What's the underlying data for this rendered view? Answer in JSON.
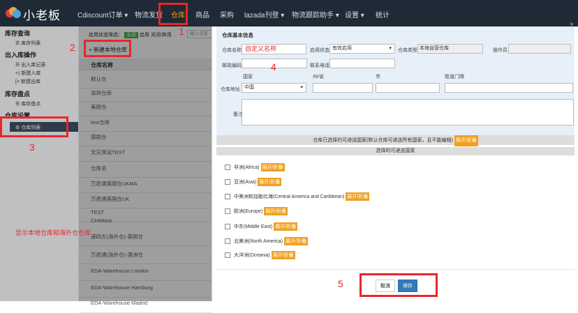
{
  "app": {
    "logo_text": "小老板"
  },
  "nav": [
    "Cdiscount订单 ▾",
    "物流发货",
    "仓库",
    "商品",
    "采购",
    "lazada刊登 ▾",
    "物流跟踪助手 ▾",
    "设置 ▾",
    "统计"
  ],
  "sidebar": {
    "sections": [
      {
        "title": "库存查询",
        "items": [
          "☰ 库存列表"
        ]
      },
      {
        "title": "出入库操作",
        "items": [
          "☰ 出入库记录",
          "+) 新建入库",
          "[> 新建出库"
        ]
      },
      {
        "title": "库存盘点",
        "items": [
          "☰ 库存盘点"
        ]
      },
      {
        "title": "仓库设置",
        "items": [
          "⚙ 仓库列表"
        ]
      }
    ]
  },
  "filter": {
    "label": "启用状态筛选：",
    "all": "全部",
    "enabled": "启用",
    "closed": "关闭/弃用",
    "search_placeholder": "输入仓库"
  },
  "new_button": "+ 新建本地仓库",
  "table": {
    "header": "仓库名称",
    "rows": [
      "默认仓",
      "深圳仓库",
      "美国仓",
      "test仓库",
      "德国仓",
      "文兄测试TEST",
      "仓库名",
      "万邑通英国仓UKMA",
      "万邑通英国仓UK",
      "TEST",
      "CHWtest",
      "递四方(海外仓)-英国仓",
      "万邑通(海外仓)-澳洲仓",
      "EDA-Warehouse London",
      "EDA-Warehouse Hamburg",
      "EDA-Warehouse Madrid"
    ]
  },
  "modal": {
    "title": "仓库基本信息",
    "name_label": "仓库名称",
    "name_value": "自定义名称",
    "status_label": "启用状态",
    "status_value": "有效启用",
    "type_label": "仓库类型",
    "type_value": "本地自营仓库",
    "operator_label": "操作员",
    "zip_label": "邮政编码",
    "phone_label": "联系电话",
    "addr_cols": [
      "国家",
      "州/省",
      "市",
      "街道门牌"
    ],
    "addr_label": "仓库地址",
    "country_value": "中国",
    "remark_label": "备注",
    "ship_note": "仓库已选择的可递送国家(默认仓库可递送所有国家，且不能编辑)",
    "expand": "展开/折叠",
    "select_title": "选择的可递送国家",
    "continents": [
      "非洲(Africa)",
      "亚洲(Asia)",
      "中美洲和加勒比海(Central America and Caribbean)",
      "欧洲(Europe)",
      "中东(Middle East)",
      "北美洲(North America)",
      "大洋洲(Oceania)"
    ],
    "cancel": "取消",
    "save": "保存",
    "close": "×"
  },
  "annotations": {
    "n1": "1",
    "n2": "2",
    "n3": "3",
    "n4": "4",
    "n5": "5",
    "note": "显示本地仓库和海外仓仓库"
  }
}
